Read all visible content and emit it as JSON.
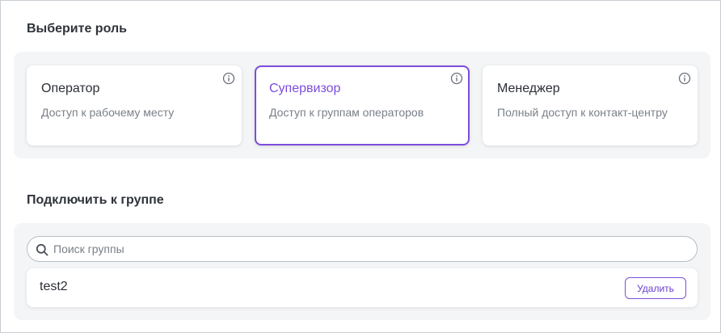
{
  "roles_section": {
    "title": "Выберите роль",
    "cards": [
      {
        "title": "Оператор",
        "description": "Доступ к рабочему месту",
        "selected": false
      },
      {
        "title": "Супервизор",
        "description": "Доступ к группам операторов",
        "selected": true
      },
      {
        "title": "Менеджер",
        "description": "Полный доступ к контакт-центру",
        "selected": false
      }
    ]
  },
  "groups_section": {
    "title": "Подключить к группе",
    "search": {
      "placeholder": "Поиск группы",
      "value": ""
    },
    "groups": [
      {
        "name": "test2",
        "delete_label": "Удалить"
      }
    ]
  },
  "colors": {
    "accent": "#7c4ddb",
    "panel_bg": "#f4f5f6",
    "muted_text": "#7a8088"
  },
  "icons": {
    "info": "info-icon",
    "search": "search-icon"
  }
}
